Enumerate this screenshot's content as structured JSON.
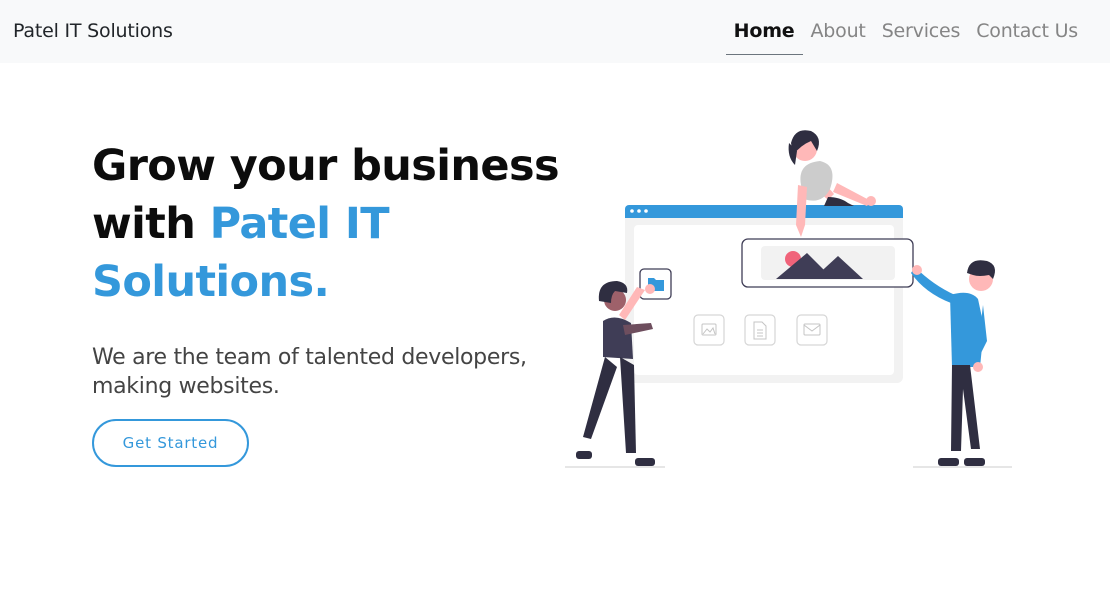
{
  "navbar": {
    "brand": "Patel IT Solutions",
    "links": [
      {
        "label": "Home",
        "active": true
      },
      {
        "label": "About",
        "active": false
      },
      {
        "label": "Services",
        "active": false
      },
      {
        "label": "Contact Us",
        "active": false
      }
    ]
  },
  "hero": {
    "title_line1": "Grow your business",
    "title_with": "with ",
    "title_accent": "Patel IT Solutions.",
    "subtitle": "We are the team of talented developers, making websites.",
    "cta_label": "Get Started",
    "illustration": "team-building-website-illustration"
  },
  "colors": {
    "accent": "#3498db",
    "navbar_bg": "#f8f9fa",
    "heading": "#0c0c0c",
    "subtitle": "#444444",
    "nav_inactive": "#858585",
    "figure_dark": "#2f2e41",
    "figure_pink": "#ffb8b8",
    "picture_red": "#f0637a"
  }
}
